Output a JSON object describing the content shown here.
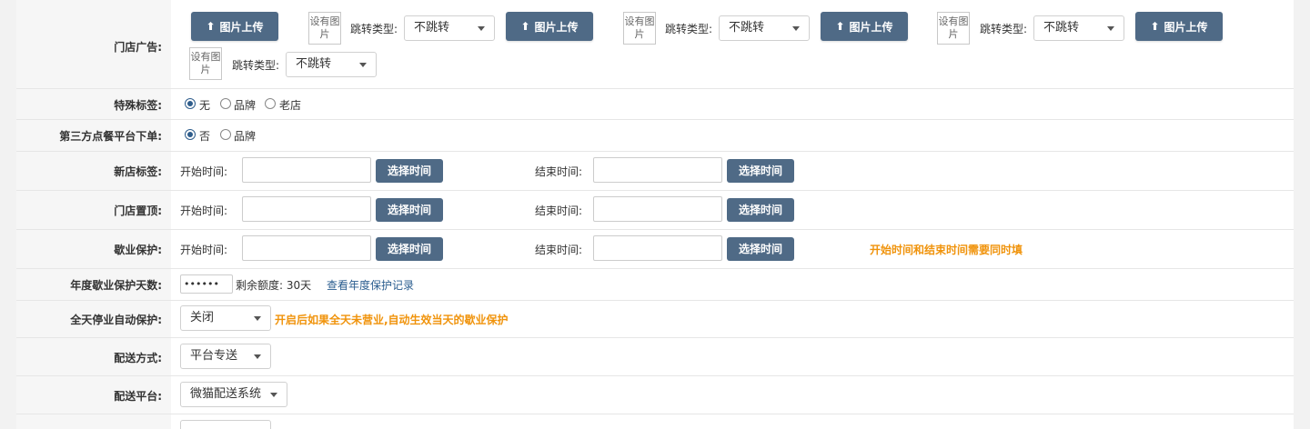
{
  "store_ads": {
    "label": "门店广告:",
    "upload_label": "图片上传",
    "thumb_text": "设有图片",
    "jump_label": "跳转类型:",
    "jump_value": "不跳转"
  },
  "special_tag": {
    "label": "特殊标签:",
    "options": [
      "无",
      "品牌",
      "老店"
    ],
    "selected": "无"
  },
  "third_party": {
    "label": "第三方点餐平台下单:",
    "options": [
      "否",
      "品牌"
    ],
    "selected": "否"
  },
  "time_rows": {
    "start_label": "开始时间:",
    "end_label": "结束时间:",
    "pick_label": "选择时间",
    "new_store_label": "新店标签:",
    "pin_label": "门店置顶:",
    "closed_label": "歇业保护:",
    "closed_hint": "开始时间和结束时间需要同时填"
  },
  "yearly": {
    "label": "年度歇业保护天数:",
    "value": "••••••",
    "remaining": "剩余额度: 30天",
    "history_link": "查看年度保护记录"
  },
  "auto_protect": {
    "label": "全天停业自动保护:",
    "value": "关闭",
    "hint": "开启后如果全天未营业,自动生效当天的歇业保护"
  },
  "delivery_method": {
    "label": "配送方式:",
    "value": "平台专送"
  },
  "delivery_platform": {
    "label": "配送平台:",
    "value": "微猫配送系统"
  }
}
